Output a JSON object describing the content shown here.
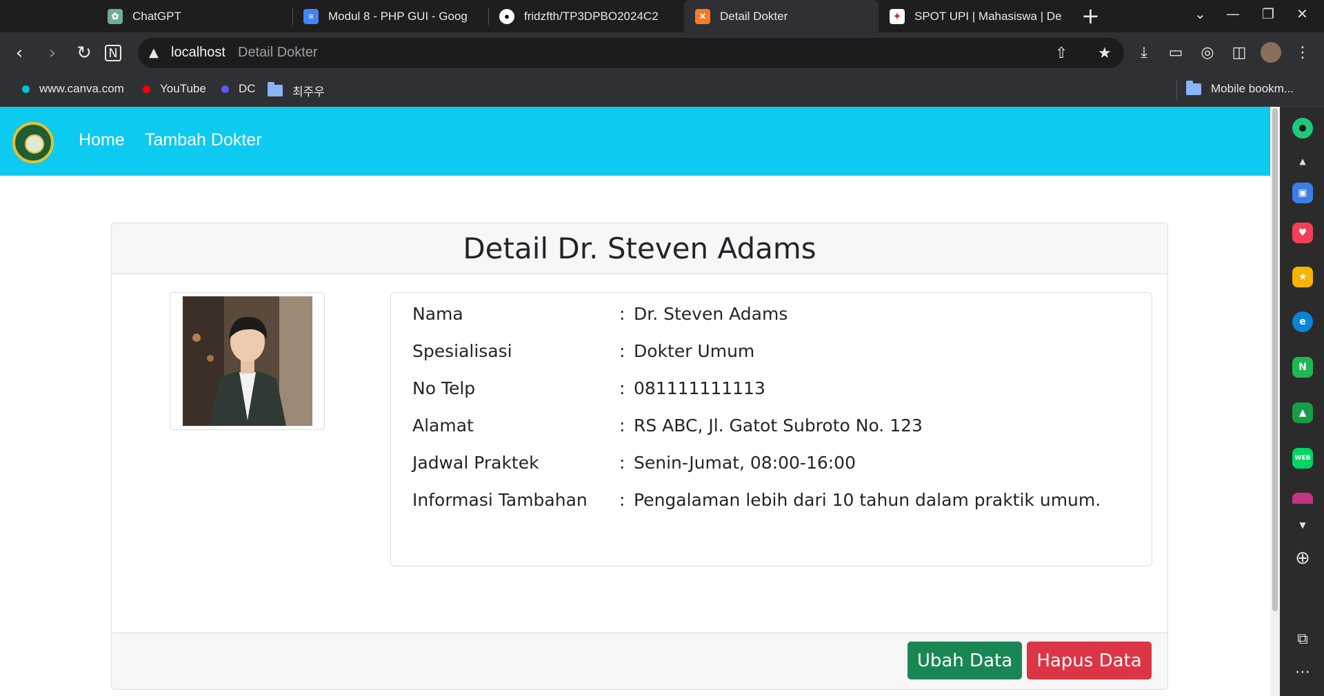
{
  "browser": {
    "tabs": [
      {
        "label": "ChatGPT",
        "favicon": "chatgpt-icon"
      },
      {
        "label": "Modul 8 - PHP GUI - Goog",
        "favicon": "google-docs-icon"
      },
      {
        "label": "fridzfth/TP3DPBO2024C2",
        "favicon": "github-icon"
      },
      {
        "label": "Detail Dokter",
        "favicon": "xampp-icon",
        "active": true
      },
      {
        "label": "SPOT UPI | Mahasiswa | De",
        "favicon": "upi-icon"
      }
    ],
    "address": {
      "host": "localhost",
      "page_title": "Detail Dokter"
    },
    "bookmarks": [
      {
        "label": "www.canva.com",
        "color": "#00c4cc"
      },
      {
        "label": "YouTube",
        "color": "#ff0000"
      },
      {
        "label": "DC",
        "color": "#5b5bf7"
      },
      {
        "label": "최주우",
        "type": "folder"
      },
      {
        "label": "Mobile bookm...",
        "type": "folder"
      }
    ]
  },
  "app": {
    "nav": {
      "home": "Home",
      "add_doctor": "Tambah Dokter"
    },
    "page_title": "Detail Dr. Steven Adams",
    "details": [
      {
        "label": "Nama",
        "value": "Dr. Steven Adams"
      },
      {
        "label": "Spesialisasi",
        "value": "Dokter Umum"
      },
      {
        "label": "No Telp",
        "value": "081111111113"
      },
      {
        "label": "Alamat",
        "value": "RS ABC, Jl. Gatot Subroto No. 123"
      },
      {
        "label": "Jadwal Praktek",
        "value": "Senin-Jumat, 08:00-16:00"
      },
      {
        "label": "Informasi Tambahan",
        "value": "Pengalaman lebih dari 10 tahun dalam praktik umum."
      }
    ],
    "separator": ":",
    "buttons": {
      "edit": "Ubah Data",
      "delete": "Hapus Data"
    },
    "colors": {
      "navbar": "#0dcaf0",
      "edit_button": "#198754",
      "delete_button": "#dc3545"
    }
  }
}
